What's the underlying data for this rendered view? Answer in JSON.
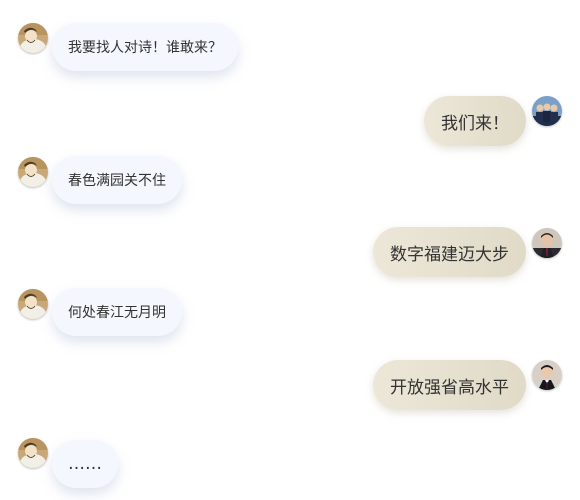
{
  "messages": [
    {
      "side": "left",
      "avatar": "poet-avatar",
      "text": "我要找人对诗！谁敢来？"
    },
    {
      "side": "right",
      "avatar": "group-avatar",
      "text": "我们来！"
    },
    {
      "side": "left",
      "avatar": "poet-avatar",
      "text": "春色满园关不住"
    },
    {
      "side": "right",
      "avatar": "man-avatar",
      "text": "数字福建迈大步"
    },
    {
      "side": "left",
      "avatar": "poet-avatar",
      "text": "何处春江无月明"
    },
    {
      "side": "right",
      "avatar": "man-avatar-2",
      "text": "开放强省高水平"
    },
    {
      "side": "left",
      "avatar": "poet-avatar",
      "text": "……"
    }
  ],
  "colors": {
    "left_bubble": "#f4f7fd",
    "right_bubble": "#e6e0cf",
    "text": "#333333"
  }
}
